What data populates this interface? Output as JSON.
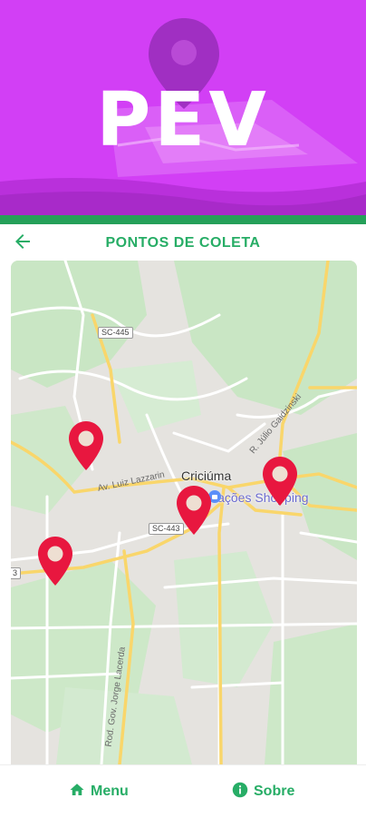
{
  "header": {
    "logo_text": "PEV",
    "background_color": "#d23ff5",
    "accent_color": "#25a059"
  },
  "title_bar": {
    "back_icon": "arrow-left-icon",
    "title": "PONTOS DE COLETA"
  },
  "map": {
    "city": "Criciúma",
    "place": "Nações Shopping",
    "place_icon": "shopping-bag-icon",
    "road_shields": [
      "SC-445",
      "SC-443",
      "3"
    ],
    "streets": [
      "Av. Luiz Lazzarin",
      "R. Júlio Gaidzinski",
      "Rod. Gov. Jorge Lacerda"
    ],
    "marker_count": 4,
    "marker_color": "#e8173f"
  },
  "bottom_nav": {
    "menu_label": "Menu",
    "menu_icon": "home-icon",
    "about_label": "Sobre",
    "about_icon": "info-icon"
  }
}
